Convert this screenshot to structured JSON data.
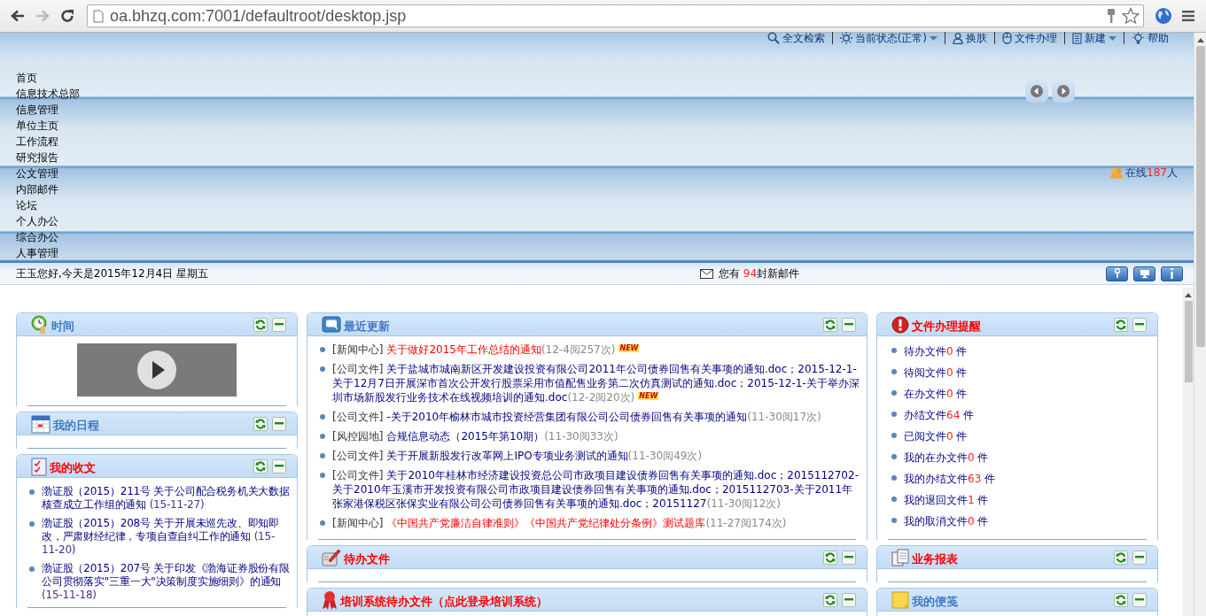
{
  "browser": {
    "url": "oa.bhzq.com:7001/defaultroot/desktop.jsp",
    "forward_disabled": true
  },
  "toplinks": [
    {
      "label": "全文检索",
      "dropdown": false
    },
    {
      "label": "当前状态(正常)",
      "dropdown": true
    },
    {
      "label": "换肤",
      "dropdown": false
    },
    {
      "label": "文件办理",
      "dropdown": false
    },
    {
      "label": "新建",
      "dropdown": true
    },
    {
      "label": "帮助",
      "dropdown": false
    }
  ],
  "menu": [
    "首页",
    "信息技术总部",
    "信息管理",
    "单位主页",
    "工作流程",
    "研究报告",
    "公文管理",
    "内部邮件",
    "论坛",
    "个人办公",
    "综合办公",
    "人事管理"
  ],
  "online": {
    "prefix": "在线",
    "count": "187",
    "suffix": "人"
  },
  "greeting": "王玉您好,今天是2015年12月4日 星期五",
  "mail": {
    "prefix": "您有 ",
    "count": "94",
    "suffix": "封新邮件"
  },
  "columns": [
    {
      "panels": [
        {
          "title": "时间",
          "emphasis": false,
          "kind": "video"
        },
        {
          "title": "我的日程",
          "emphasis": false,
          "kind": "empty"
        },
        {
          "title": "我的收文",
          "emphasis": true,
          "kind": "docs",
          "items": [
            {
              "text": "渤证股（2015）211号 关于公司配合税务机关大数据核查成立工作组的通知",
              "date": "(15-11-27)",
              "hot": false
            },
            {
              "text": "渤证股（2015）208号 关于开展未巡先改、即知即改，严肃财经纪律，专项自查自纠工作的通知",
              "date": "(15-11-20)",
              "hot": false
            },
            {
              "text": "渤证股（2015）207号 关于印发《渤海证券股份有限公司贯彻落实\"三重一大\"决策制度实施细则》的通知",
              "date": "(15-11-18)",
              "hot": false
            }
          ]
        }
      ]
    },
    {
      "panels": [
        {
          "title": "最近更新",
          "emphasis": false,
          "kind": "news",
          "items": [
            {
              "category": "[新闻中心]",
              "title": "关于做好2015年工作总结的通知",
              "meta": "(12-4阅257次)",
              "hot": true,
              "badge": "NEW"
            },
            {
              "category": "[公司文件]",
              "title": "关于盐城市城南新区开发建设投资有限公司2011年公司债券回售有关事项的通知.doc；2015-12-1-关于12月7日开展深市首次公开发行股票采用市值配售业务第二次仿真测试的通知.doc；2015-12-1-关于举办深圳市场新股发行业务技术在线视频培训的通知.doc",
              "meta": "(12-2阅20次)",
              "hot": false,
              "badge": "NEW"
            },
            {
              "category": "[公司文件]",
              "title": "-关于2010年榆林市城市投资经营集团有限公司公司债券回售有关事项的通知",
              "meta": "(11-30阅17次)",
              "hot": false
            },
            {
              "category": "[风控园地]",
              "title": "合规信息动态（2015年第10期）",
              "meta": "(11-30阅33次)",
              "hot": false
            },
            {
              "category": "[公司文件]",
              "title": "关于开展新股发行改革网上IPO专项业务测试的通知",
              "meta": "(11-30阅49次)",
              "hot": false
            },
            {
              "category": "[公司文件]",
              "title": "关于2010年桂林市经济建设投资总公司市政项目建设债券回售有关事项的通知.doc；2015112702-关于2010年玉溪市开发投资有限公司市政项目建设债券回售有关事项的通知.doc；2015112703-关于2011年张家港保税区张保实业有限公司公司债券回售有关事项的通知.doc；20151127",
              "meta": "(11-30阅12次)",
              "hot": false
            },
            {
              "category": "[新闻中心]",
              "title": "《中国共产党廉洁自律准则》《中国共产党纪律处分条例》测试题库",
              "meta": "(11-27阅174次)",
              "hot": true
            }
          ]
        },
        {
          "title": "待办文件",
          "emphasis": true,
          "kind": "empty"
        },
        {
          "title": "培训系统待办文件（点此登录培训系统）",
          "emphasis": true,
          "kind": "empty"
        }
      ]
    },
    {
      "panels": [
        {
          "title": "文件办理提醒",
          "emphasis": true,
          "kind": "counts",
          "items": [
            {
              "label": "待办文件",
              "count": "0",
              "unit": " 件"
            },
            {
              "label": "待阅文件",
              "count": "0",
              "unit": " 件"
            },
            {
              "label": "在办文件",
              "count": "0",
              "unit": " 件"
            },
            {
              "label": "办结文件",
              "count": "64",
              "unit": " 件"
            },
            {
              "label": "已阅文件",
              "count": "0",
              "unit": " 件"
            },
            {
              "label": "我的在办文件",
              "count": "0",
              "unit": " 件"
            },
            {
              "label": "我的办结文件",
              "count": "63",
              "unit": " 件"
            },
            {
              "label": "我的退回文件",
              "count": "1",
              "unit": " 件"
            },
            {
              "label": "我的取消文件",
              "count": "0",
              "unit": " 件"
            }
          ]
        },
        {
          "title": "业务报表",
          "emphasis": true,
          "kind": "empty"
        },
        {
          "title": "我的便笺",
          "emphasis": false,
          "kind": "empty"
        }
      ]
    }
  ]
}
